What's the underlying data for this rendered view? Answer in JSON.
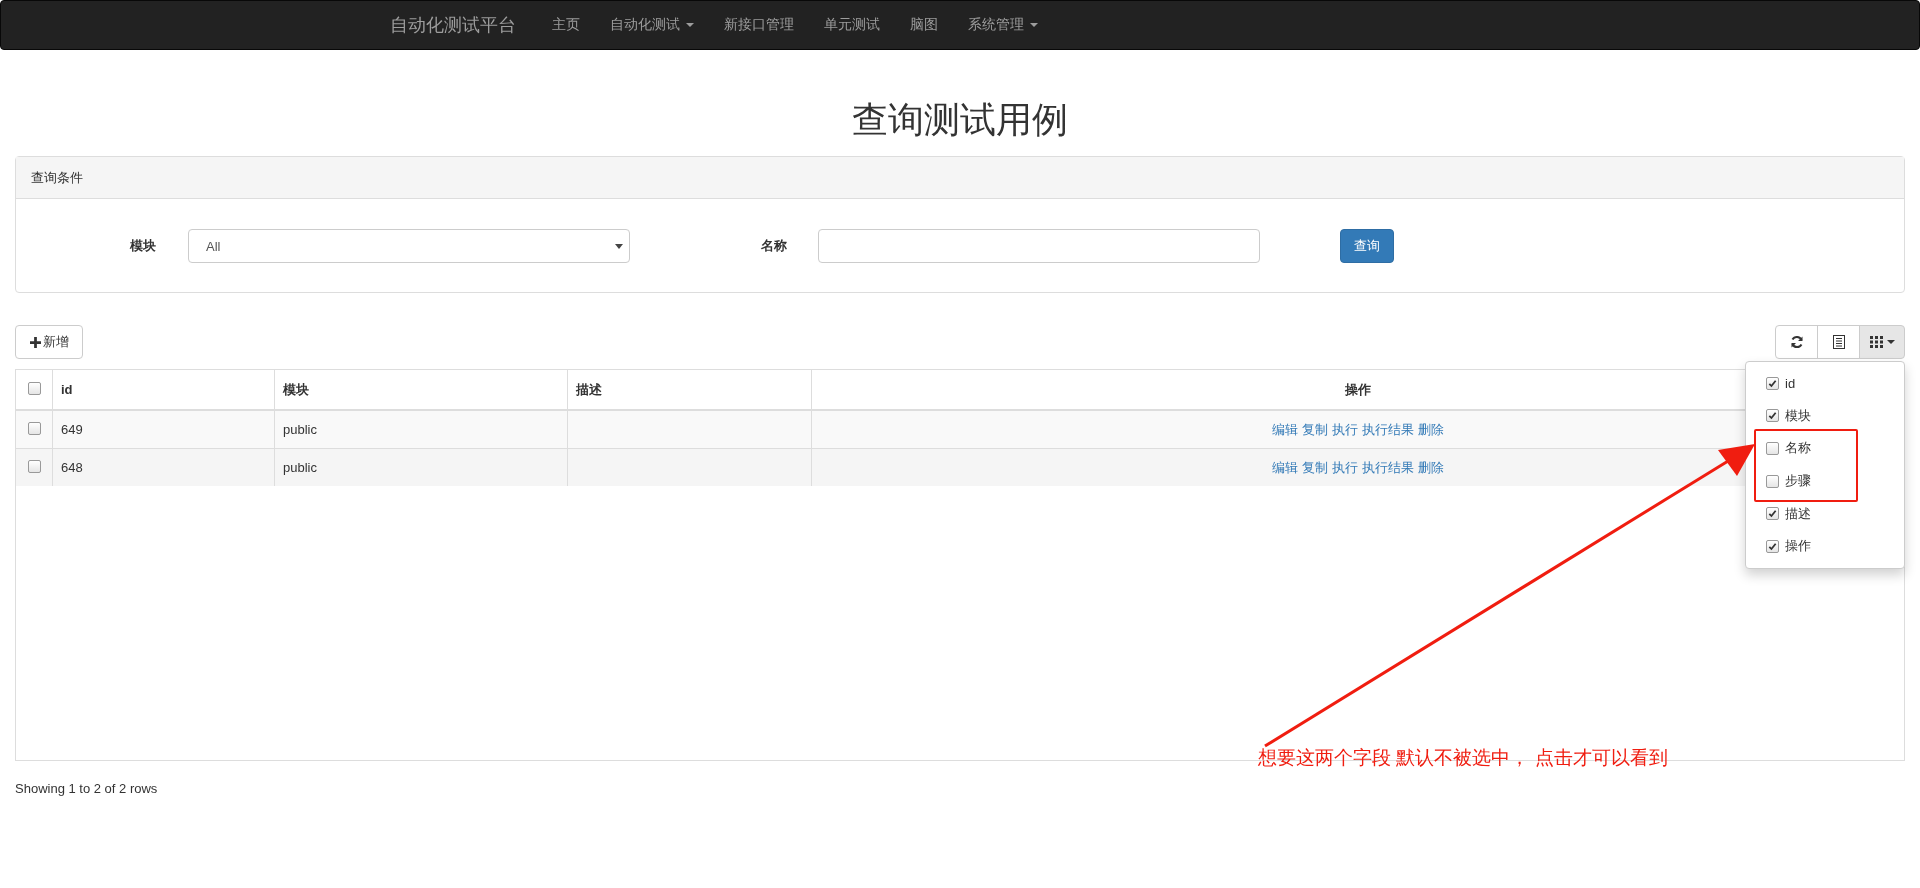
{
  "navbar": {
    "brand": "自动化测试平台",
    "items": [
      {
        "label": "主页",
        "dropdown": false
      },
      {
        "label": "自动化测试",
        "dropdown": true
      },
      {
        "label": "新接口管理",
        "dropdown": false
      },
      {
        "label": "单元测试",
        "dropdown": false
      },
      {
        "label": "脑图",
        "dropdown": false
      },
      {
        "label": "系统管理",
        "dropdown": true
      }
    ]
  },
  "page_title": "查询测试用例",
  "query_panel": {
    "heading": "查询条件",
    "module_label": "模块",
    "module_value": "All",
    "name_label": "名称",
    "search_button": "查询"
  },
  "toolbar": {
    "add_button": "新增"
  },
  "table": {
    "columns": [
      "id",
      "模块",
      "描述",
      "操作"
    ],
    "all_checked": false,
    "rows": [
      {
        "checked": false,
        "id": "649",
        "module": "public",
        "description": "",
        "actions": [
          "编辑",
          "复制",
          "执行",
          "执行结果",
          "删除"
        ]
      },
      {
        "checked": false,
        "id": "648",
        "module": "public",
        "description": "",
        "actions": [
          "编辑",
          "复制",
          "执行",
          "执行结果",
          "删除"
        ]
      }
    ]
  },
  "columns_menu": {
    "items": [
      {
        "label": "id",
        "checked": true,
        "highlighted": false
      },
      {
        "label": "模块",
        "checked": true,
        "highlighted": false
      },
      {
        "label": "名称",
        "checked": false,
        "highlighted": true
      },
      {
        "label": "步骤",
        "checked": false,
        "highlighted": true
      },
      {
        "label": "描述",
        "checked": true,
        "highlighted": false
      },
      {
        "label": "操作",
        "checked": true,
        "highlighted": false
      }
    ]
  },
  "pagination": {
    "summary": "Showing 1 to 2 of 2 rows"
  },
  "annotation": {
    "text": "想要这两个字段 默认不被选中， 点击才可以看到"
  }
}
